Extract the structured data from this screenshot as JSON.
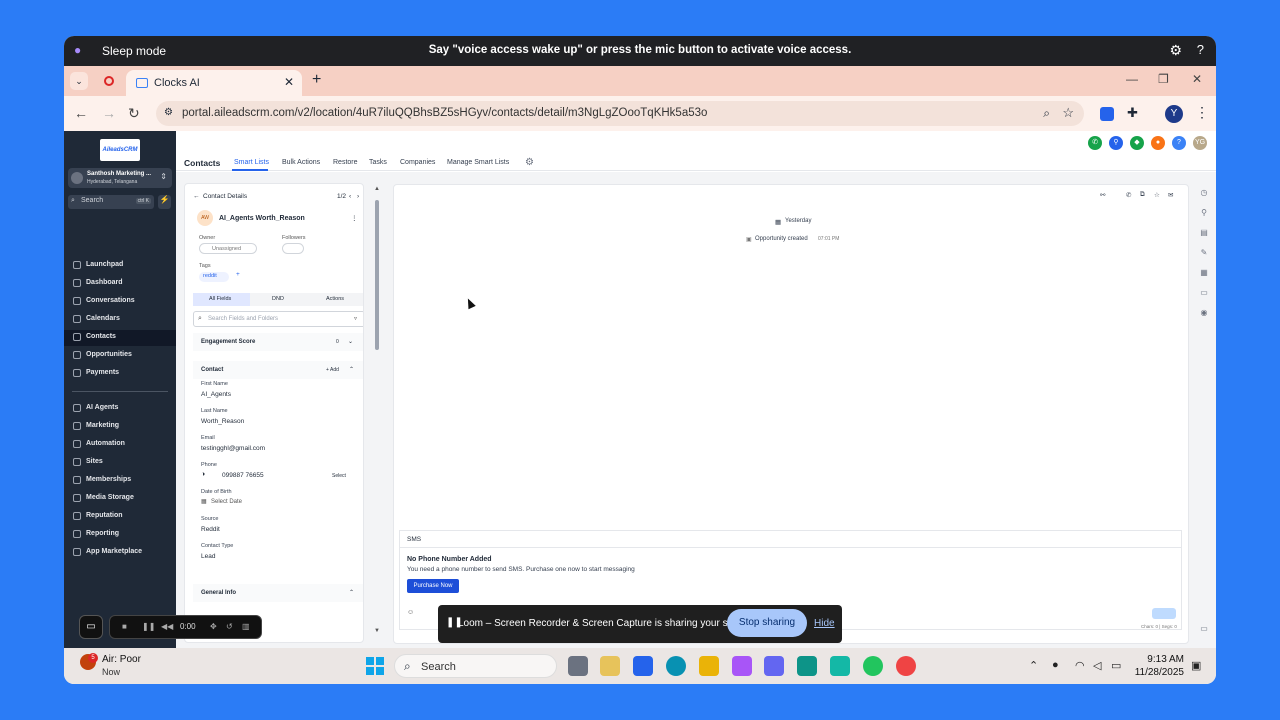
{
  "voice_bar": {
    "status": "Sleep mode",
    "message": "Say \"voice access wake up\" or press the mic button to activate voice access."
  },
  "browser": {
    "tab_title": "Clocks AI",
    "url": "portal.aileadscrm.com/v2/location/4uR7iluQQBhsBZ5sHGyv/contacts/detail/m3NgLgZOooTqKHk5a53o",
    "profile_initial": "Y"
  },
  "sidebar": {
    "logo_text": "AileadsCRM",
    "account_name": "Santhosh Marketing ...",
    "account_location": "Hyderabad, Telangana",
    "search_placeholder": "Search",
    "search_shortcut": "ctrl K",
    "items_top": [
      {
        "label": "Launchpad"
      },
      {
        "label": "Dashboard"
      },
      {
        "label": "Conversations"
      },
      {
        "label": "Calendars"
      },
      {
        "label": "Contacts"
      },
      {
        "label": "Opportunities"
      },
      {
        "label": "Payments"
      }
    ],
    "items_bottom": [
      {
        "label": "AI Agents"
      },
      {
        "label": "Marketing"
      },
      {
        "label": "Automation"
      },
      {
        "label": "Sites"
      },
      {
        "label": "Memberships"
      },
      {
        "label": "Media Storage"
      },
      {
        "label": "Reputation"
      },
      {
        "label": "Reporting"
      },
      {
        "label": "App Marketplace"
      }
    ],
    "active_item": "Contacts"
  },
  "header": {
    "title": "Contacts",
    "nav": [
      "Smart Lists",
      "Bulk Actions",
      "Restore",
      "Tasks",
      "Companies",
      "Manage Smart Lists"
    ],
    "active_nav": "Smart Lists",
    "user_initials": "YG"
  },
  "contact_panel": {
    "back_label": "Contact Details",
    "pager": "1/2",
    "avatar_initials": "AW",
    "contact_name": "AI_Agents Worth_Reason",
    "owner_label": "Owner",
    "owner_value": "Unassigned",
    "followers_label": "Followers",
    "tags_label": "Tags",
    "tag": "reddit",
    "tabs": [
      "All Fields",
      "DND",
      "Actions"
    ],
    "search_placeholder": "Search Fields and Folders",
    "engagement_label": "Engagement Score",
    "engagement_value": "0",
    "section_contact": "Contact",
    "add_label": "Add",
    "fields": [
      {
        "label": "First Name",
        "value": "AI_Agents"
      },
      {
        "label": "Last Name",
        "value": "Worth_Reason"
      },
      {
        "label": "Email",
        "value": "testingghl@gmail.com"
      },
      {
        "label": "Phone",
        "value": "099887 76655"
      },
      {
        "label": "Date of Birth",
        "value": "Select Date"
      },
      {
        "label": "Source",
        "value": "Reddit"
      },
      {
        "label": "Contact Type",
        "value": "Lead"
      }
    ],
    "phone_select": "Select",
    "section_general": "General Info"
  },
  "activity": {
    "date_label": "Yesterday",
    "event_label": "Opportunity created",
    "event_time": "07:01 PM"
  },
  "sms": {
    "tab_label": "SMS",
    "heading": "No Phone Number Added",
    "subtext": "You need a phone number to send SMS. Purchase one now to start messaging",
    "button_label": "Purchase Now",
    "counter": "Chars: 0 | Segs: 0"
  },
  "loom": {
    "timer": "0:00",
    "share_message": "Loom – Screen Recorder & Screen Capture is sharing your screen.",
    "stop_label": "Stop sharing",
    "hide_label": "Hide"
  },
  "taskbar": {
    "weather_title": "Air: Poor",
    "weather_sub": "Now",
    "weather_badge": "5",
    "search_label": "Search",
    "time": "9:13 AM",
    "date": "11/28/2025"
  },
  "colors": {
    "desktop": "#2b7cf6",
    "sidebar": "#1f2937",
    "accent": "#2563eb",
    "tab_bar": "#f6d0c4"
  }
}
